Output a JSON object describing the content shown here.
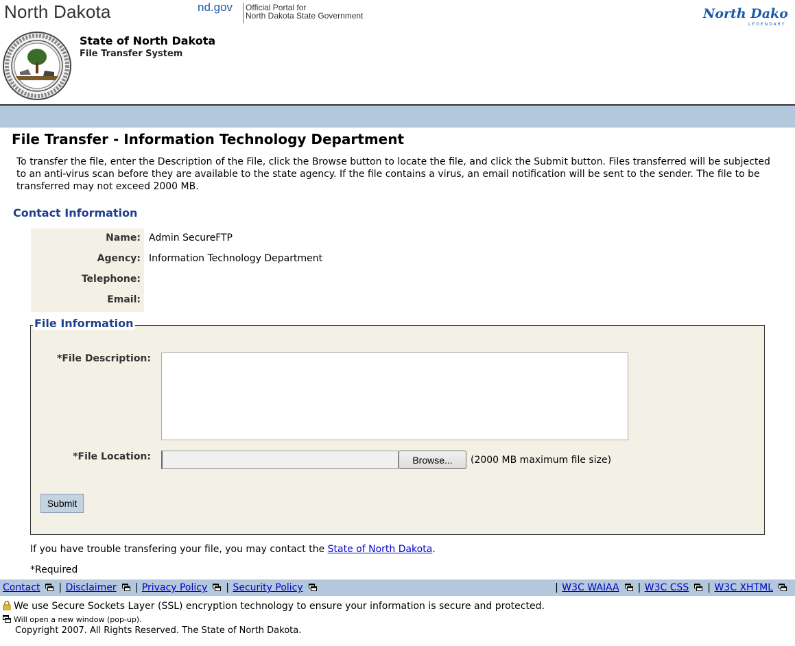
{
  "header": {
    "brand": "North Dakota",
    "portal_domain": "nd.gov",
    "portal_line1": "Official Portal for",
    "portal_line2": "North Dakota State Government",
    "logo_text": "North Dakota",
    "logo_tagline": "LEGENDARY",
    "state_title": "State of North Dakota",
    "system_title": "File Transfer System"
  },
  "page": {
    "title": "File Transfer - Information Technology Department",
    "intro": "To transfer the file, enter the Description of the File, click the Browse button to locate the file, and click the Submit button. Files transferred will be subjected to an anti-virus scan before they are available to the state agency. If the file contains a virus, an email notification will be sent to the sender. The file to be transferred may not exceed 2000 MB."
  },
  "contact": {
    "heading": "Contact Information",
    "name_label": "Name:",
    "name_value": "Admin SecureFTP",
    "agency_label": "Agency:",
    "agency_value": "Information Technology Department",
    "telephone_label": "Telephone:",
    "telephone_value": "",
    "email_label": "Email:",
    "email_value": ""
  },
  "file_info": {
    "legend": "File Information",
    "description_label": "*File Description:",
    "description_value": "",
    "location_label": "*File Location:",
    "location_value": "",
    "browse_label": "Browse...",
    "max_note": "(2000 MB maximum file size)",
    "submit_label": "Submit"
  },
  "help": {
    "trouble_prefix": "If you have trouble transfering your file, you may contact the ",
    "trouble_link": "State of North Dakota",
    "trouble_suffix": ".",
    "required": "*Required"
  },
  "footer": {
    "links_left": [
      "Contact",
      "Disclaimer",
      "Privacy Policy",
      "Security Policy"
    ],
    "links_right": [
      "W3C WAIAA",
      "W3C CSS",
      "W3C XHTML"
    ],
    "ssl_note": "We use Secure Sockets Layer (SSL) encryption technology to ensure your information is secure and protected.",
    "popup_note": "Will open a new window (pop-up).",
    "copyright": "Copyright 2007. All Rights Reserved. The State of North Dakota."
  },
  "colors": {
    "band": "#b3c8dc",
    "heading_blue": "#1f3e8c",
    "link": "#0000cc",
    "panel": "#f3f1e6"
  }
}
